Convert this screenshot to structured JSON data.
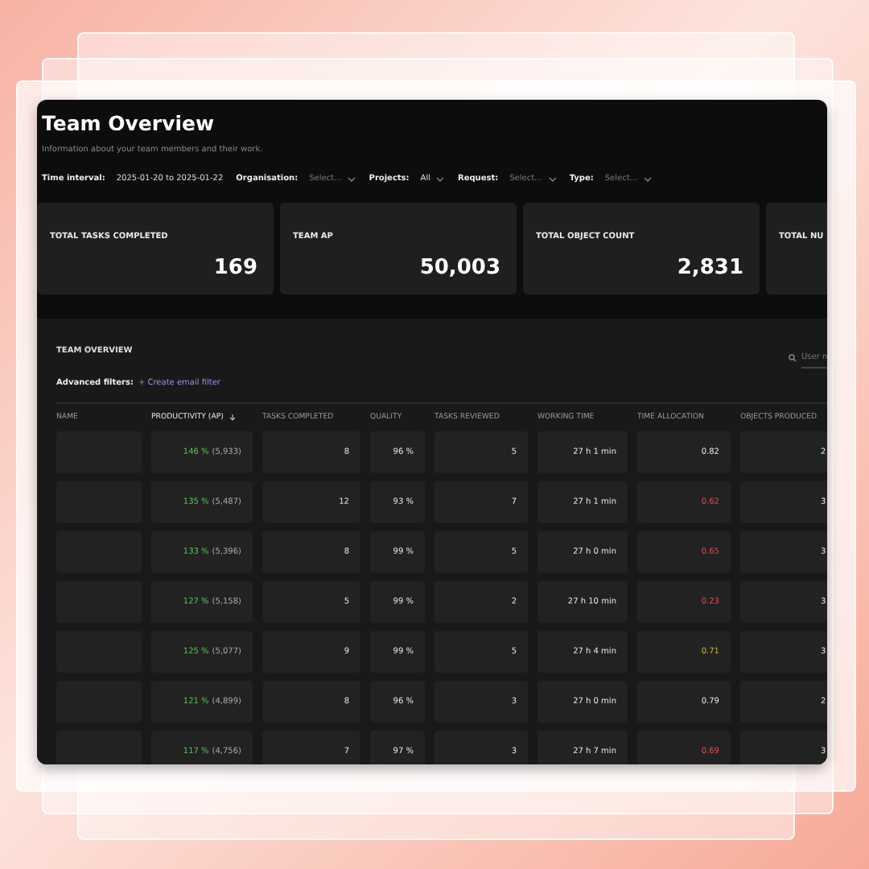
{
  "header": {
    "title": "Team Overview",
    "subtitle": "Information about your team members and their work."
  },
  "filters": [
    {
      "label": "Time interval:",
      "value": "2025-01-20 to 2025-01-22",
      "kind": "text"
    },
    {
      "label": "Organisation:",
      "placeholder": "Select...",
      "kind": "dropdown"
    },
    {
      "label": "Projects:",
      "value": "All",
      "kind": "dropdown"
    },
    {
      "label": "Request:",
      "placeholder": "Select...",
      "kind": "dropdown"
    },
    {
      "label": "Type:",
      "placeholder": "Select...",
      "kind": "dropdown"
    }
  ],
  "stats": [
    {
      "label": "TOTAL TASKS COMPLETED",
      "value": "169"
    },
    {
      "label": "TEAM AP",
      "value": "50,003"
    },
    {
      "label": "TOTAL OBJECT COUNT",
      "value": "2,831"
    },
    {
      "label": "TOTAL NU"
    }
  ],
  "table": {
    "title": "TEAM OVERVIEW",
    "advanced_label": "Advanced filters:",
    "create_filter": "+ Create email filter",
    "search": {
      "placeholder": "User n"
    },
    "columns": [
      {
        "label": "NAME",
        "sorted": false
      },
      {
        "label": "PRODUCTIVITY (AP)",
        "sorted": true
      },
      {
        "label": "TASKS COMPLETED",
        "sorted": false
      },
      {
        "label": "QUALITY",
        "sorted": false
      },
      {
        "label": "TASKS REVIEWED",
        "sorted": false
      },
      {
        "label": "WORKING TIME",
        "sorted": false
      },
      {
        "label": "TIME ALLOCATION",
        "sorted": false
      },
      {
        "label": "OBJECTS PRODUCED",
        "sorted": false
      }
    ],
    "rows": [
      {
        "productivity": "146 %",
        "ap": "(5,933)",
        "tasks": "8",
        "quality": "96 %",
        "reviewed": "5",
        "time": "27 h 1 min",
        "allocation": "0.82",
        "color": "#e6e6e6",
        "objects": "2"
      },
      {
        "productivity": "135 %",
        "ap": "(5,487)",
        "tasks": "12",
        "quality": "93 %",
        "reviewed": "7",
        "time": "27 h 1 min",
        "allocation": "0.62",
        "color": "#e0504a",
        "objects": "3"
      },
      {
        "productivity": "133 %",
        "ap": "(5,396)",
        "tasks": "8",
        "quality": "99 %",
        "reviewed": "5",
        "time": "27 h 0 min",
        "allocation": "0.65",
        "color": "#e0504a",
        "objects": "3"
      },
      {
        "productivity": "127 %",
        "ap": "(5,158)",
        "tasks": "5",
        "quality": "99 %",
        "reviewed": "2",
        "time": "27 h 10 min",
        "allocation": "0.23",
        "color": "#e0504a",
        "objects": "3"
      },
      {
        "productivity": "125 %",
        "ap": "(5,077)",
        "tasks": "9",
        "quality": "99 %",
        "reviewed": "5",
        "time": "27 h 4 min",
        "allocation": "0.71",
        "color": "#d9b23a",
        "objects": "3"
      },
      {
        "productivity": "121 %",
        "ap": "(4,899)",
        "tasks": "8",
        "quality": "96 %",
        "reviewed": "3",
        "time": "27 h 0 min",
        "allocation": "0.79",
        "color": "#e6e6e6",
        "objects": "2"
      },
      {
        "productivity": "117 %",
        "ap": "(4,756)",
        "tasks": "7",
        "quality": "97 %",
        "reviewed": "3",
        "time": "27 h 7 min",
        "allocation": "0.69",
        "color": "#e0504a",
        "objects": "3"
      }
    ]
  }
}
